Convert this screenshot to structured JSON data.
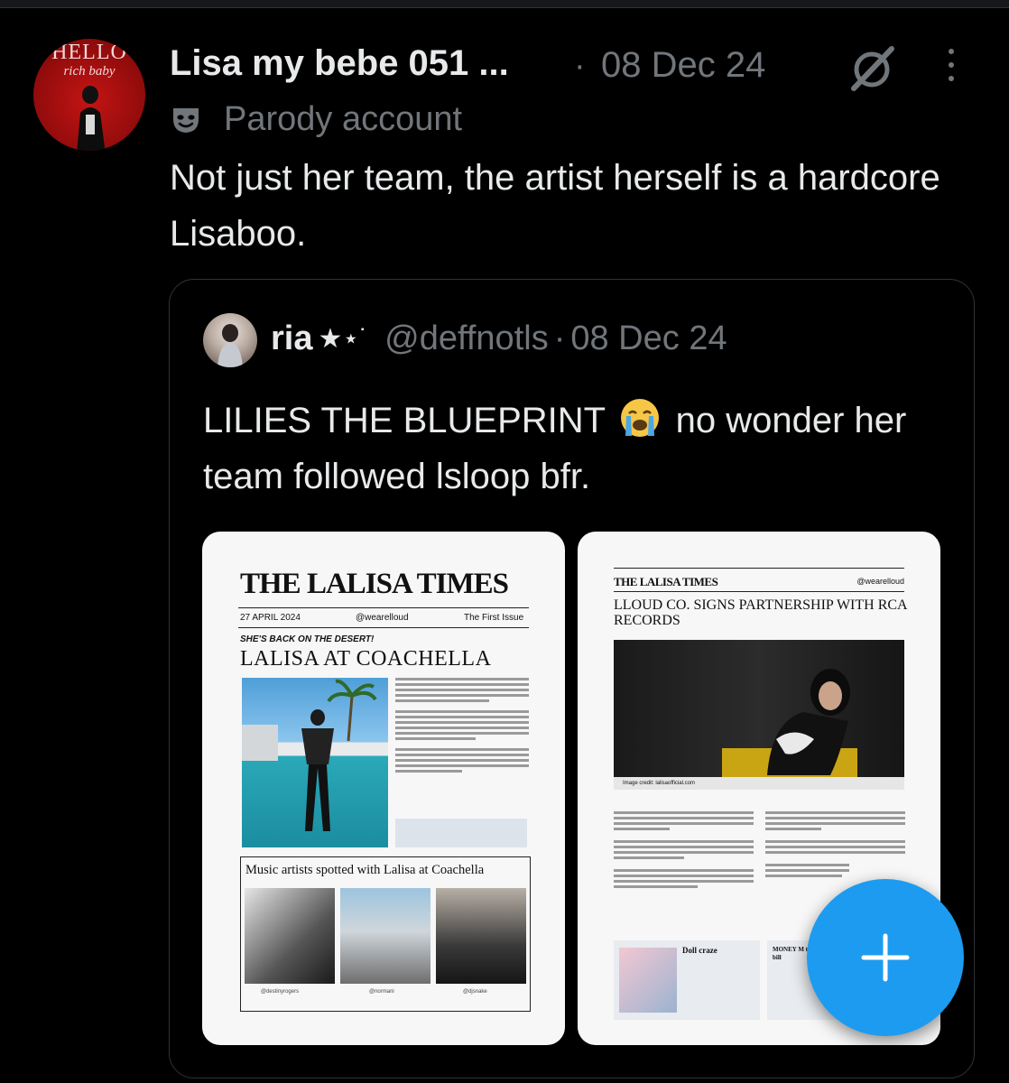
{
  "tweet": {
    "author_avatar_text_line1": "HELLO",
    "author_avatar_text_line2": "rich baby",
    "author_name": "Lisa my bebe 051 ...",
    "separator": "·",
    "date": "08 Dec 24",
    "account_label": "Parody account",
    "text": "Not just her team, the artist herself is a hardcore Lisaboo."
  },
  "quoted_tweet": {
    "name": "ria",
    "stars": "★⋆˙",
    "handle": "@deffnotls",
    "separator": "·",
    "date": "08 Dec 24",
    "text_before_emoji": "LILIES THE BLUEPRINT",
    "emoji": "loudly-crying-face",
    "text_after_emoji": "no wonder her team followed lsloop bfr."
  },
  "image1": {
    "masthead": "THE LALISA TIMES",
    "date": "27 APRIL 2024",
    "handle": "@wearelloud",
    "issue": "The First Issue",
    "kicker": "SHE'S BACK ON THE DESERT!",
    "headline": "LALISA AT COACHELLA",
    "box_title": "Music artists spotted with Lalisa at Coachella",
    "credits": [
      "@destinyrogers",
      "@normani",
      "@djsnake"
    ]
  },
  "image2": {
    "masthead": "THE LALISA TIMES",
    "handle": "@wearelloud",
    "headline": "LLOUD CO. SIGNS PARTNERSHIP WITH RCA RECORDS",
    "photo_credit": "Image credit: lalisaofficial.com",
    "card1_title": "Doll craze",
    "card2_title": "MONEY M to hit a bill"
  },
  "fab": {
    "icon": "plus-icon"
  },
  "colors": {
    "background": "#000000",
    "text": "#e7e9ea",
    "muted": "#71767b",
    "accent": "#1d9bf0",
    "border": "#2f3336"
  }
}
